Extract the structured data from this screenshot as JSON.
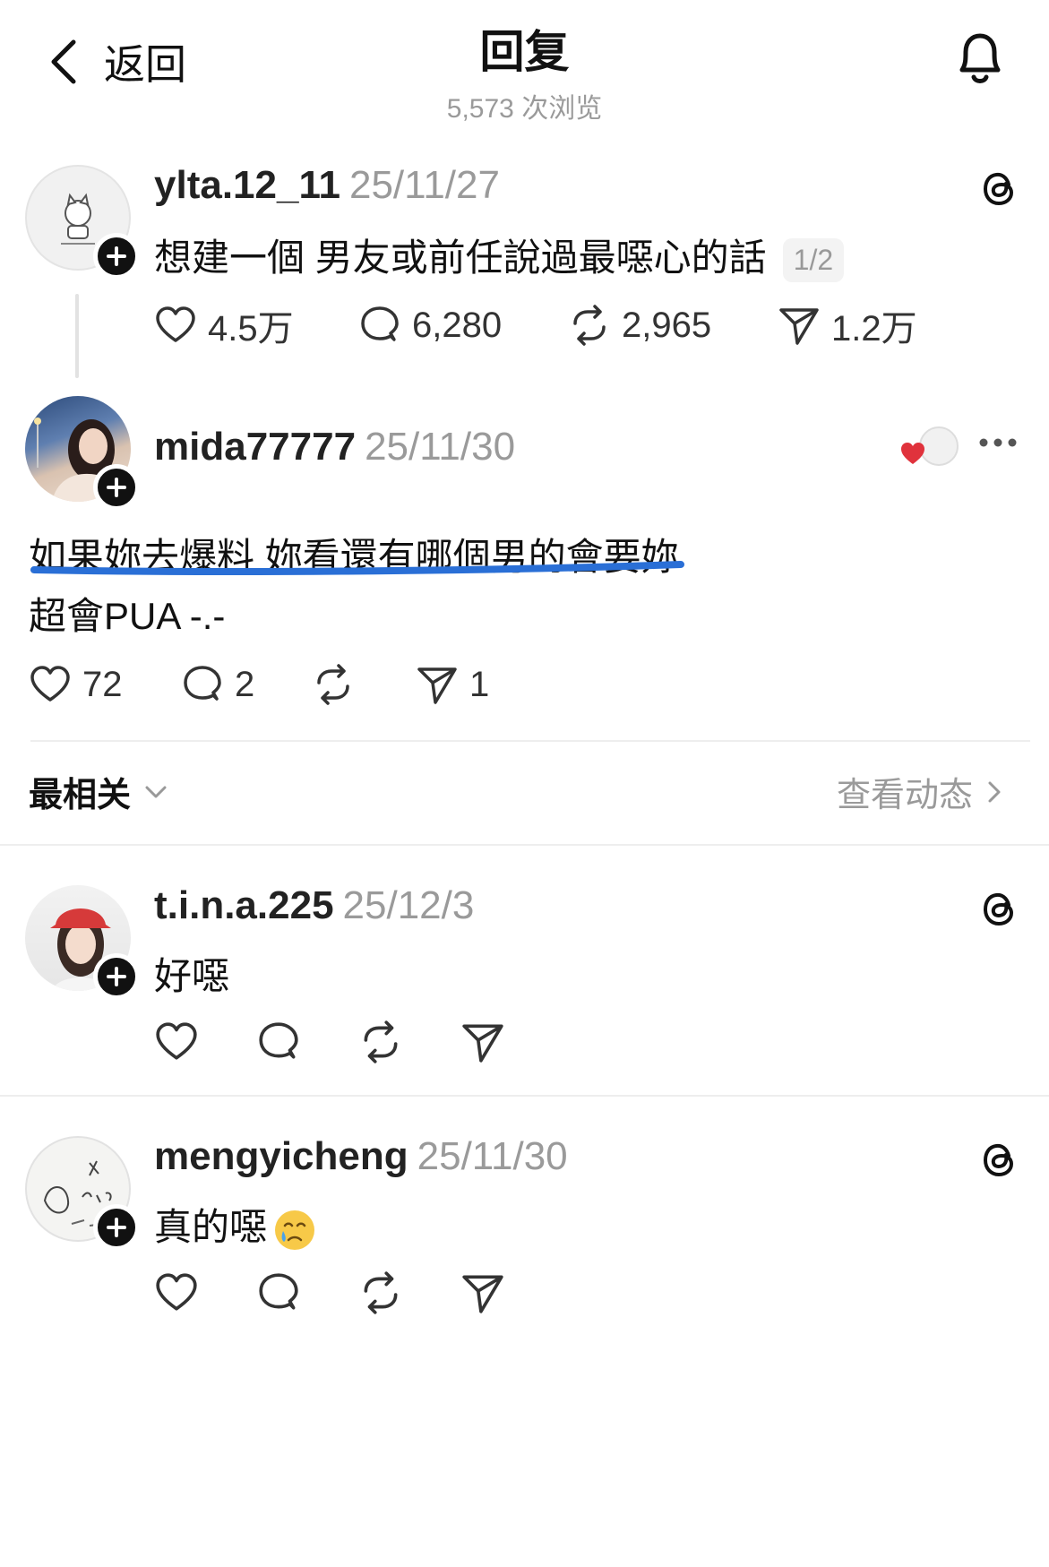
{
  "header": {
    "back_label": "返回",
    "title": "回复",
    "views": "5,573 次浏览"
  },
  "original_post": {
    "username": "ylta.12_11",
    "date": "25/11/27",
    "text": "想建一個 男友或前任說過最噁心的話",
    "page_badge": "1/2",
    "likes": "4.5万",
    "comments": "6,280",
    "reposts": "2,965",
    "shares": "1.2万"
  },
  "reply_post": {
    "username": "mida77777",
    "date": "25/11/30",
    "line1": "如果妳去爆料 妳看還有哪個男的會要妳",
    "line2": "超會PUA -.-",
    "likes": "72",
    "comments": "2",
    "shares": "1"
  },
  "sort": {
    "label": "最相关",
    "activity_label": "查看动态"
  },
  "comments": [
    {
      "username": "t.i.n.a.225",
      "date": "25/12/3",
      "text": "好噁"
    },
    {
      "username": "mengyicheng",
      "date": "25/11/30",
      "text": "真的噁"
    }
  ],
  "colors": {
    "underline": "#2a6fd6",
    "heart_badge": "#e0323c",
    "muted": "#9a9a9a"
  }
}
